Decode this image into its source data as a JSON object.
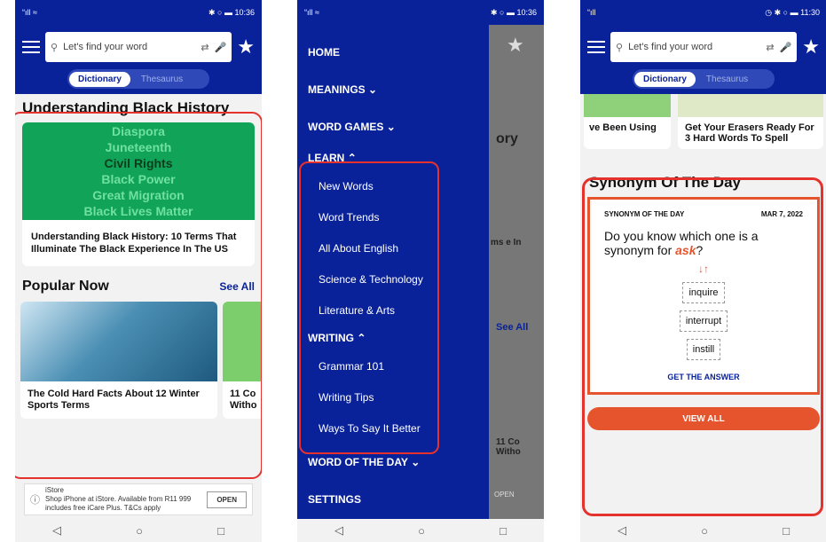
{
  "screen1": {
    "status_time": "10:36",
    "status_left": "“ıll ≈",
    "status_icons": "✱ ○ ▬",
    "search_placeholder": "Let's find your word",
    "tab_dictionary": "Dictionary",
    "tab_thesaurus": "Thesaurus",
    "hero_title": "Understanding Black History",
    "hero_words": [
      "Diaspora",
      "Juneteenth",
      "Civil Rights",
      "Black Power",
      "Great Migration",
      "Black Lives Matter"
    ],
    "hero_card_title": "Understanding Black History: 10 Terms That Illuminate The Black Experience In The US",
    "popular_title": "Popular Now",
    "see_all": "See All",
    "popular_card1": "The Cold Hard Facts About 12 Winter Sports Terms",
    "popular_card2": "11 Co Witho",
    "ad_brand": "iStore",
    "ad_text": "Shop iPhone at iStore. Available from R11 999 includes free iCare Plus. T&Cs apply",
    "ad_open": "OPEN"
  },
  "screen2": {
    "status_time": "10:36",
    "status_left": "“ıll ≈",
    "status_icons": "✱ ○ ▬",
    "menu_home": "HOME",
    "menu_meanings": "MEANINGS",
    "menu_word_games": "WORD GAMES",
    "menu_learn": "LEARN",
    "learn_items": [
      "New Words",
      "Word Trends",
      "All About English",
      "Science & Technology",
      "Literature & Arts"
    ],
    "menu_writing": "WRITING",
    "writing_items": [
      "Grammar 101",
      "Writing Tips",
      "Ways To Say It Better"
    ],
    "menu_word_of_day": "WORD OF THE DAY",
    "menu_settings": "SETTINGS",
    "peek_text1": "ory",
    "peek_text2": "ms e In",
    "peek_see_all": "See All",
    "peek_text3": "11 Co Witho",
    "peek_open": "OPEN"
  },
  "screen3": {
    "status_time": "11:30",
    "status_left": "“ıll",
    "status_icons": "◷ ✱ ○ ▬",
    "search_placeholder": "Let's find your word",
    "tab_dictionary": "Dictionary",
    "tab_thesaurus": "Thesaurus",
    "article_left": "ve Been Using",
    "article_right": "Get Your Erasers Ready For 3 Hard Words To Spell",
    "syn_title": "Synonym Of The Day",
    "syn_label": "SYNONYM OF THE DAY",
    "syn_date": "MAR 7, 2022",
    "syn_question_prefix": "Do you know which one is a synonym for",
    "syn_word": "ask",
    "syn_question_suffix": "?",
    "options": [
      "inquire",
      "interrupt",
      "instill"
    ],
    "get_answer": "GET THE ANSWER",
    "view_all": "VIEW ALL"
  },
  "nav": {
    "back": "◁",
    "home": "○",
    "recent": "□"
  },
  "colors": {
    "brand_blue": "#0a2299",
    "accent_orange": "#e5542d",
    "highlight_red": "#e5322d",
    "hero_green": "#11a458"
  }
}
